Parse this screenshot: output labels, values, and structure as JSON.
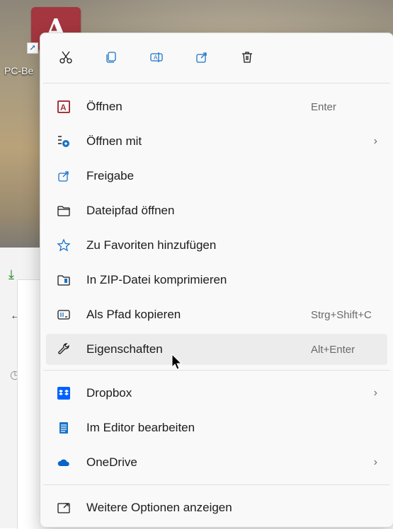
{
  "desktop": {
    "shortcut_label": "PC-Be",
    "shortcut_icon_letter": "A"
  },
  "toolbar": {
    "actions": [
      {
        "name": "cut",
        "icon": "scissors-icon"
      },
      {
        "name": "copy",
        "icon": "copy-icon"
      },
      {
        "name": "rename",
        "icon": "rename-icon"
      },
      {
        "name": "share",
        "icon": "share-icon"
      },
      {
        "name": "delete",
        "icon": "trash-icon"
      }
    ]
  },
  "menu": {
    "items": [
      {
        "label": "Öffnen",
        "shortcut": "Enter",
        "icon": "access-app-icon"
      },
      {
        "label": "Öffnen mit",
        "has_submenu": true,
        "icon": "open-with-icon"
      },
      {
        "label": "Freigabe",
        "icon": "share-icon"
      },
      {
        "label": "Dateipfad öffnen",
        "icon": "folder-icon"
      },
      {
        "label": "Zu Favoriten hinzufügen",
        "icon": "star-icon"
      },
      {
        "label": "In ZIP-Datei komprimieren",
        "icon": "zip-folder-icon"
      },
      {
        "label": "Als Pfad kopieren",
        "shortcut": "Strg+Shift+C",
        "icon": "copy-path-icon"
      },
      {
        "label": "Eigenschaften",
        "shortcut": "Alt+Enter",
        "icon": "wrench-icon",
        "hovered": true
      },
      {
        "label": "Dropbox",
        "has_submenu": true,
        "icon": "dropbox-icon"
      },
      {
        "label": "Im Editor bearbeiten",
        "icon": "notepad-icon"
      },
      {
        "label": "OneDrive",
        "has_submenu": true,
        "icon": "onedrive-icon"
      },
      {
        "label": "Weitere Optionen anzeigen",
        "icon": "more-options-icon"
      }
    ],
    "chevron": "›"
  },
  "colors": {
    "menu_bg": "#f9f9f9",
    "hover_bg": "#ececec",
    "accent_blue": "#1a73c8",
    "access_red": "#a4363f"
  }
}
